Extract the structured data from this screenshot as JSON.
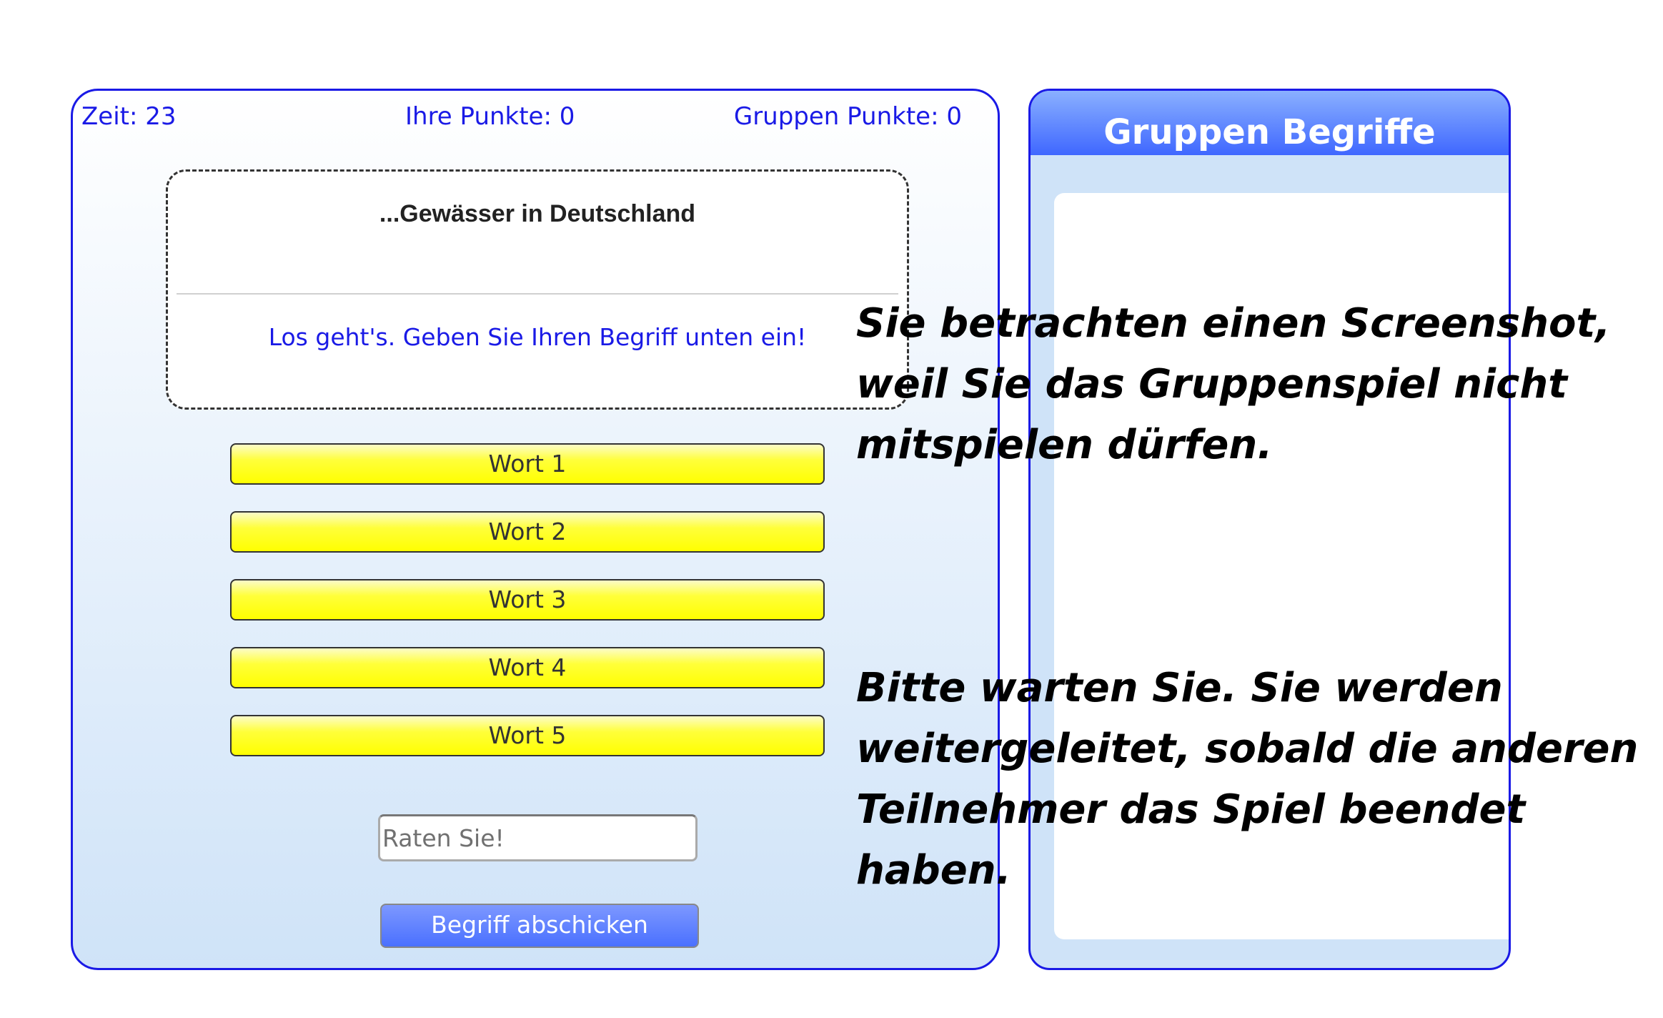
{
  "game": {
    "time_label": "Zeit: 23",
    "own_points_label": "Ihre Punkte: 0",
    "group_points_label": "Gruppen Punkte: 0",
    "topic": "...Gewässer in Deutschland",
    "message": "Los geht's. Geben Sie Ihren Begriff unten ein!",
    "words": [
      "Wort 1",
      "Wort 2",
      "Wort 3",
      "Wort 4",
      "Wort 5"
    ],
    "guess_placeholder": "Raten Sie!",
    "submit_label": "Begriff abschicken"
  },
  "group_panel": {
    "title": "Gruppen Begriffe"
  },
  "overlay": {
    "paragraph_1": "Sie betrachten einen Screenshot,\nweil Sie das Gruppenspiel nicht\nmitspielen dürfen.",
    "paragraph_2": "Bitte warten Sie. Sie werden\nweitergeleitet, sobald die anderen\nTeilnehmer das Spiel beendet\nhaben."
  },
  "colors": {
    "accent_blue": "#1a1ae6",
    "word_yellow": "#ffff00",
    "button_blue": "#4a70ff"
  }
}
